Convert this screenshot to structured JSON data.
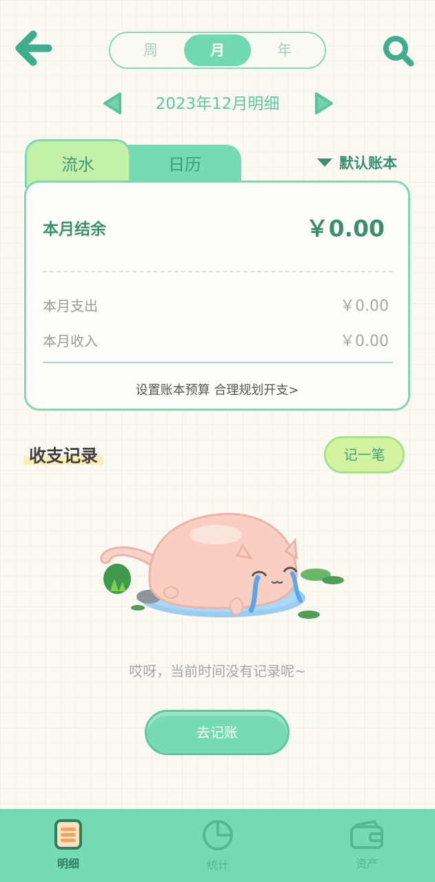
{
  "header": {
    "period_options": [
      "周",
      "月",
      "年"
    ],
    "active_period": "月",
    "date_label": "2023年12月明细"
  },
  "tabs": {
    "flow": "流水",
    "calendar": "日历",
    "ledger": "默认账本"
  },
  "summary": {
    "balance_label": "本月结余",
    "balance_value": "￥0.00",
    "expense_label": "本月支出",
    "expense_value": "￥0.00",
    "income_label": "本月收入",
    "income_value": "￥0.00",
    "budget_link": "设置账本预算 合理规划开支>"
  },
  "records": {
    "title": "收支记录",
    "record_button": "记一笔",
    "empty_text": "哎呀，当前时间没有记录呢~",
    "go_record_button": "去记账"
  },
  "bottom_nav": {
    "detail": "明细",
    "stats": "统计",
    "assets": "资产"
  },
  "colors": {
    "accent": "#74dbb4",
    "accent_dark": "#3a8f70",
    "tab_light": "#c4f1a8"
  }
}
